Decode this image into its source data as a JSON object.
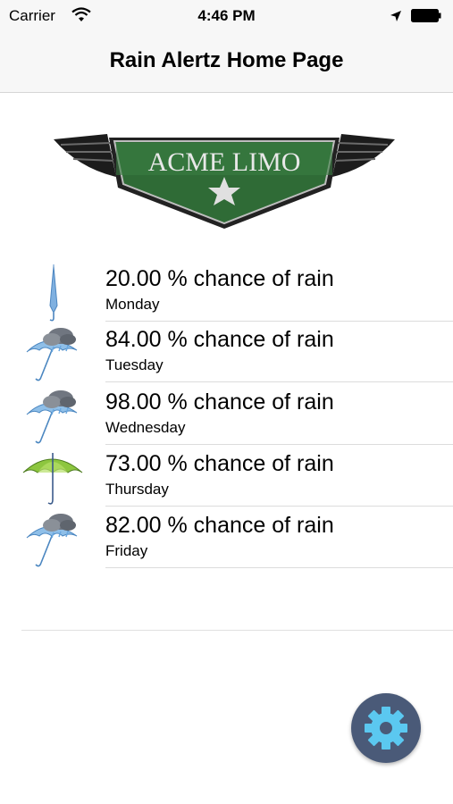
{
  "status_bar": {
    "carrier": "Carrier",
    "time": "4:46 PM"
  },
  "nav": {
    "title": "Rain Alertz Home Page"
  },
  "logo": {
    "text": "ACME LIMO"
  },
  "forecast": [
    {
      "percent_text": "20.00 % chance of rain",
      "day": "Monday",
      "icon": "closed-umbrella-icon"
    },
    {
      "percent_text": "84.00 % chance of rain",
      "day": "Tuesday",
      "icon": "storm-umbrella-icon"
    },
    {
      "percent_text": "98.00 % chance of rain",
      "day": "Wednesday",
      "icon": "storm-umbrella-icon"
    },
    {
      "percent_text": "73.00 % chance of rain",
      "day": "Thursday",
      "icon": "open-umbrella-icon"
    },
    {
      "percent_text": "82.00 % chance of rain",
      "day": "Friday",
      "icon": "storm-umbrella-icon"
    }
  ],
  "colors": {
    "accent_gear": "#5bc8f0",
    "logo_green": "#2f6b36"
  }
}
